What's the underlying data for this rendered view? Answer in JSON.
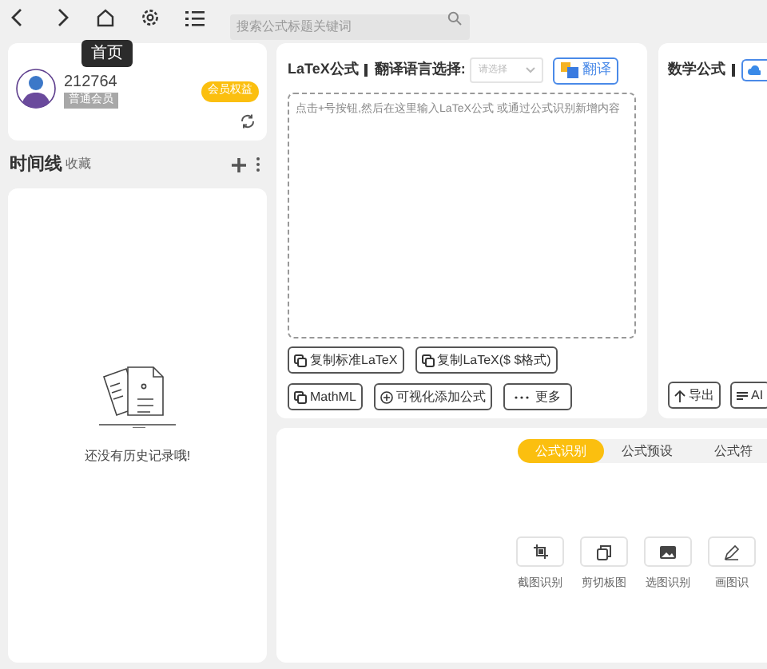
{
  "toolbar": {
    "tooltip": "首页",
    "search": {
      "placeholder": "搜索公式标题关键词"
    }
  },
  "user": {
    "id": "212764",
    "level": "普通会员",
    "benefits": "会员权益"
  },
  "timeline": {
    "title": "时间线",
    "subtitle": "收藏",
    "empty": "还没有历史记录哦!"
  },
  "latex_panel": {
    "title": "LaTeX公式",
    "language_label": "翻译语言选择:",
    "language_placeholder": "请选择",
    "translate": "翻译",
    "editor_placeholder": "点击+号按钮,然后在这里输入LaTeX公式 或通过公式识别新增内容",
    "actions": [
      {
        "kind": "copy",
        "label": "复制标准LaTeX"
      },
      {
        "kind": "copy",
        "label": "复制LaTeX($ $格式)"
      },
      {
        "kind": "copy",
        "label": "MathML"
      },
      {
        "kind": "add",
        "label": "可视化添加公式"
      },
      {
        "kind": "more",
        "label": "更多"
      }
    ]
  },
  "math_panel": {
    "title": "数学公式",
    "actions": [
      {
        "kind": "export",
        "label": "导出"
      },
      {
        "kind": "ai",
        "label": "AI"
      }
    ]
  },
  "recognize_panel": {
    "tabs": [
      {
        "label": "公式识别",
        "selected": true
      },
      {
        "label": "公式预设",
        "selected": false
      },
      {
        "label": "公式符",
        "selected": false
      }
    ],
    "tools": [
      {
        "kind": "crop",
        "label": "截图识别"
      },
      {
        "kind": "clipboard",
        "label": "剪切板图"
      },
      {
        "kind": "image",
        "label": "选图识别"
      },
      {
        "kind": "draw",
        "label": "画图识"
      }
    ]
  }
}
